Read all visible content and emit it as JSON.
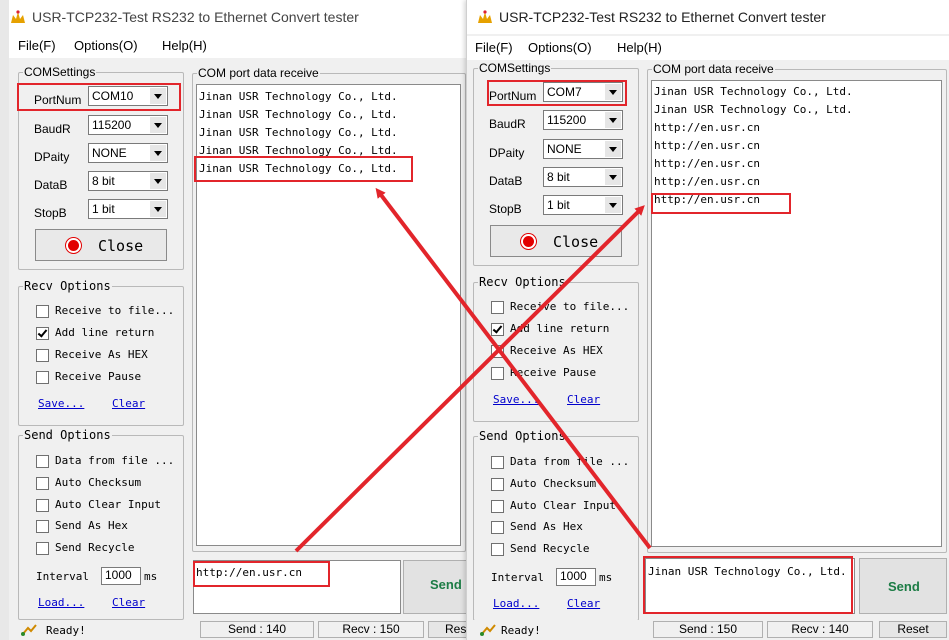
{
  "colors": {
    "highlight": "#e2252b",
    "led": "#e20000",
    "link": "#0000cc",
    "send_text": "#1c7c45"
  },
  "left": {
    "title": "USR-TCP232-Test  RS232 to Ethernet Convert tester",
    "menu": {
      "file": "File(F)",
      "options": "Options(O)",
      "help": "Help(H)"
    },
    "com_settings": {
      "legend": "COMSettings",
      "portnum_label": "PortNum",
      "portnum": "COM10",
      "baud_label": "BaudR",
      "baud": "115200",
      "parity_label": "DPaity",
      "parity": "NONE",
      "databits_label": "DataB",
      "databits": "8 bit",
      "stopbits_label": "StopB",
      "stopbits": "1 bit",
      "close_label": "Close"
    },
    "recv_options": {
      "legend": "Recv Options",
      "to_file": "Receive to file...",
      "line_return": "Add line return",
      "as_hex": "Receive As HEX",
      "pause": "Receive Pause",
      "save": "Save...",
      "clear": "Clear"
    },
    "send_options": {
      "legend": "Send Options",
      "from_file": "Data from file ...",
      "checksum": "Auto Checksum",
      "clear_input": "Auto Clear Input",
      "as_hex": "Send As Hex",
      "recycle": "Send Recycle",
      "interval_label": "Interval",
      "interval": "1000",
      "interval_unit": "ms",
      "load": "Load...",
      "clear": "Clear"
    },
    "receive": {
      "legend": "COM port data receive",
      "lines": [
        "Jinan USR Technology Co., Ltd.",
        "Jinan USR Technology Co., Ltd.",
        "Jinan USR Technology Co., Ltd.",
        "Jinan USR Technology Co., Ltd.",
        "Jinan USR Technology Co., Ltd."
      ]
    },
    "send_text": "http://en.usr.cn",
    "send_button": "Send",
    "status": {
      "ready": "Ready!",
      "send": "Send : 140",
      "recv": "Recv : 150",
      "reset": "Res"
    }
  },
  "right": {
    "title": "USR-TCP232-Test  RS232 to Ethernet Convert tester",
    "menu": {
      "file": "File(F)",
      "options": "Options(O)",
      "help": "Help(H)"
    },
    "com_settings": {
      "legend": "COMSettings",
      "portnum_label": "PortNum",
      "portnum": "COM7",
      "baud_label": "BaudR",
      "baud": "115200",
      "parity_label": "DPaity",
      "parity": "NONE",
      "databits_label": "DataB",
      "databits": "8 bit",
      "stopbits_label": "StopB",
      "stopbits": "1 bit",
      "close_label": "Close"
    },
    "recv_options": {
      "legend": "Recv Options",
      "to_file": "Receive to file...",
      "line_return": "Add line return",
      "as_hex": "Receive As HEX",
      "pause": "Receive Pause",
      "save": "Save...",
      "clear": "Clear"
    },
    "send_options": {
      "legend": "Send Options",
      "from_file": "Data from file ...",
      "checksum": "Auto Checksum",
      "clear_input": "Auto Clear Input",
      "as_hex": "Send As Hex",
      "recycle": "Send Recycle",
      "interval_label": "Interval",
      "interval": "1000",
      "interval_unit": "ms",
      "load": "Load...",
      "clear": "Clear"
    },
    "receive": {
      "legend": "COM port data receive",
      "lines": [
        "Jinan USR Technology Co., Ltd.",
        "Jinan USR Technology Co., Ltd.",
        "http://en.usr.cn",
        "http://en.usr.cn",
        "http://en.usr.cn",
        "http://en.usr.cn",
        "http://en.usr.cn"
      ]
    },
    "send_text": "Jinan USR Technology Co., Ltd.",
    "send_button": "Send",
    "status": {
      "ready": "Ready!",
      "send": "Send : 150",
      "recv": "Recv : 140",
      "reset": "Reset"
    }
  }
}
